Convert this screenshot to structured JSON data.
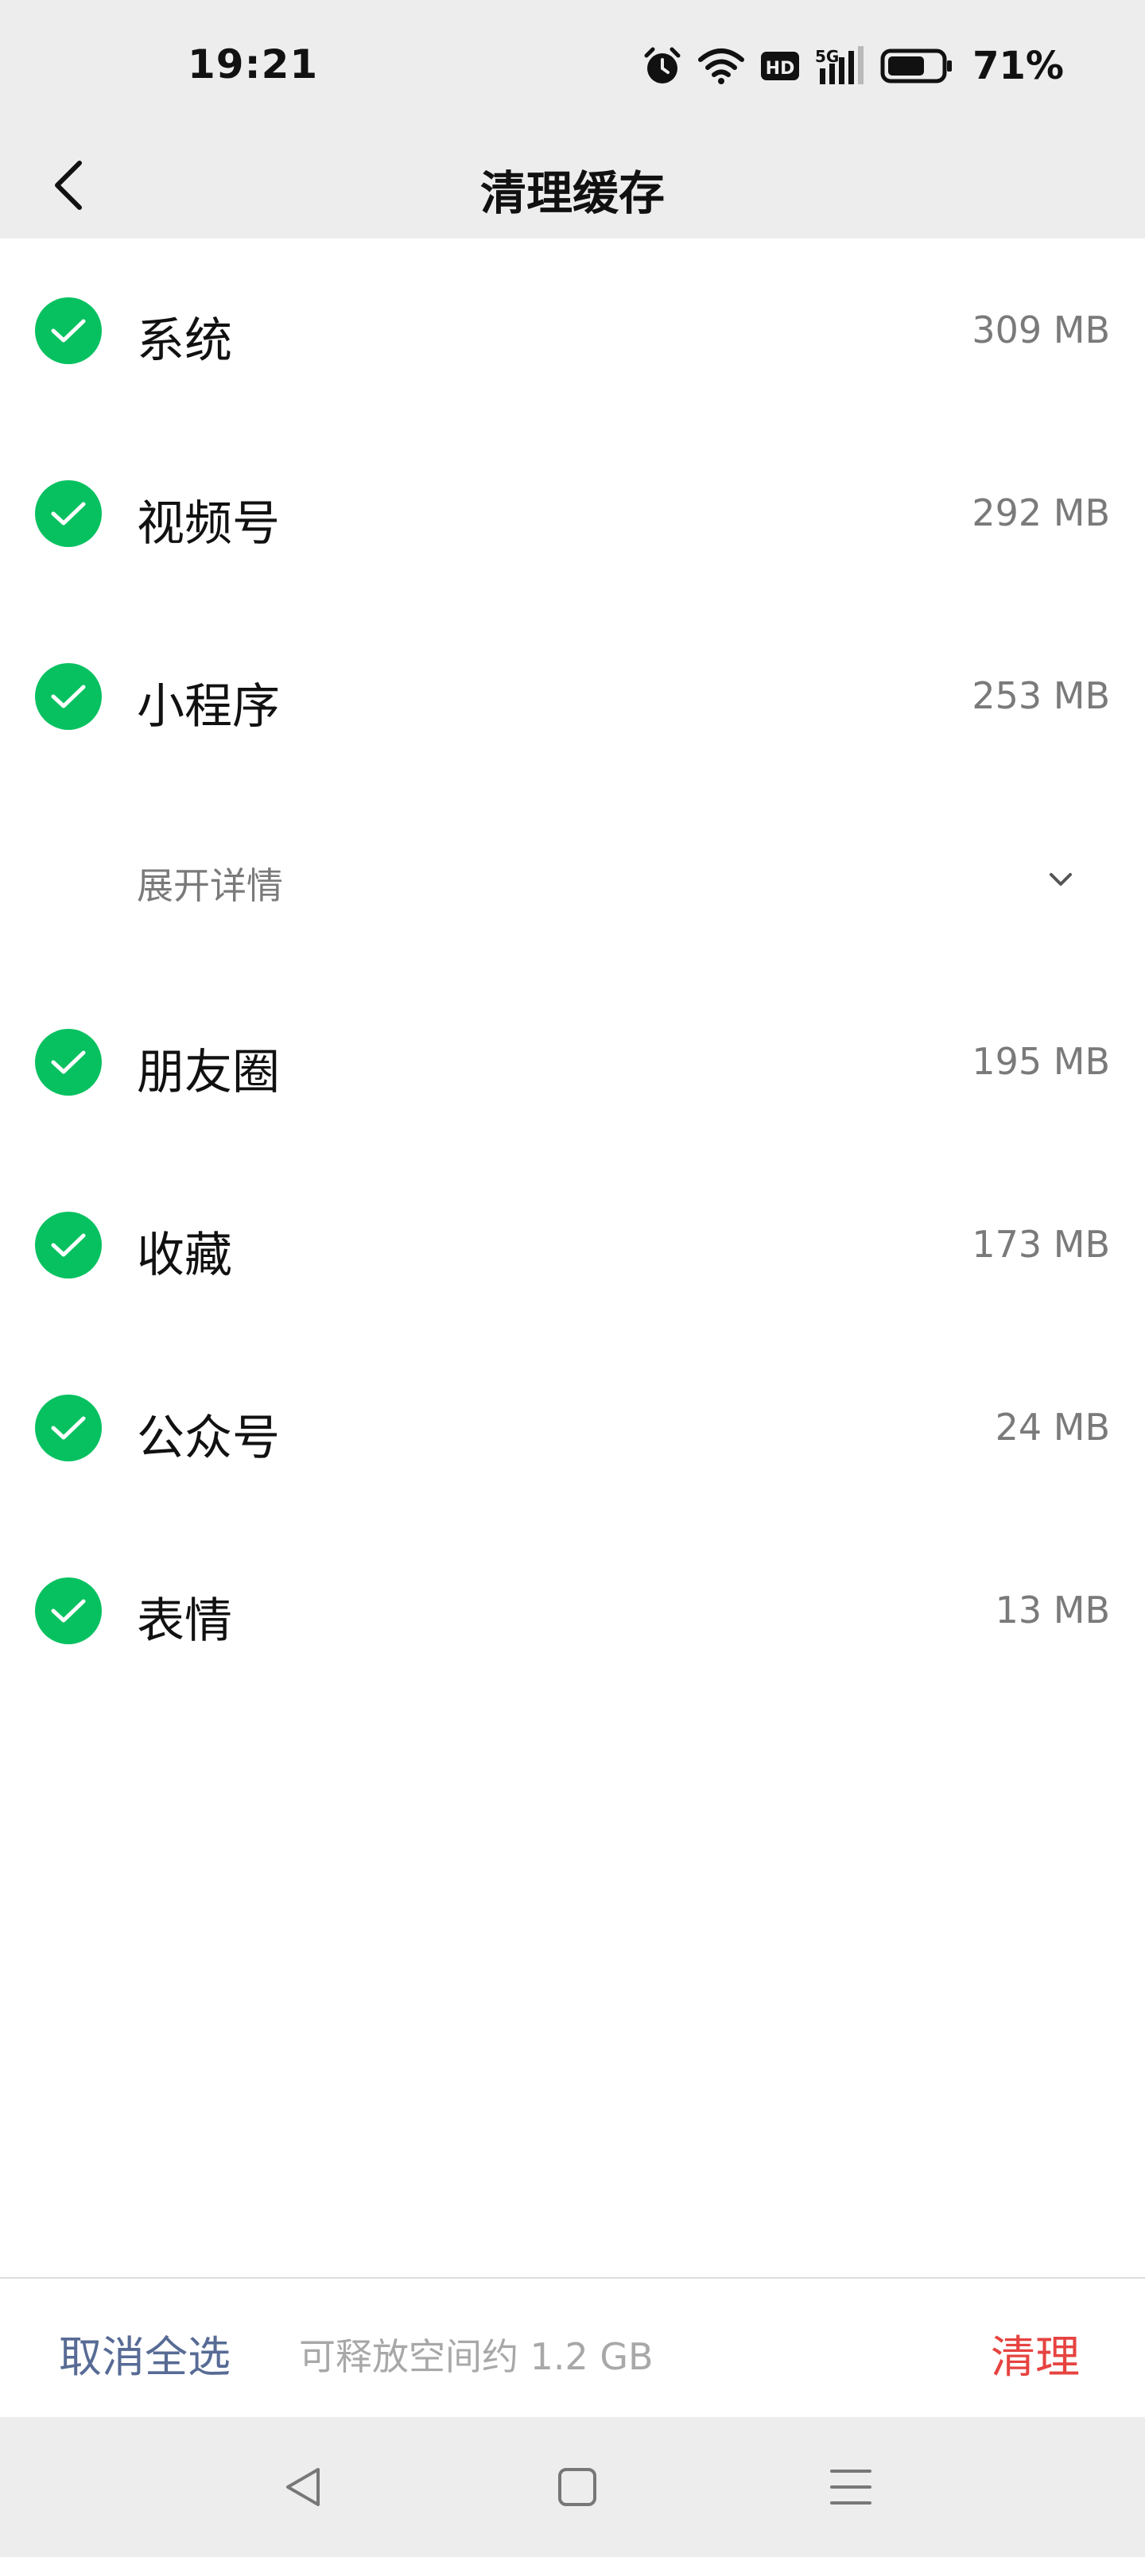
{
  "status_bar": {
    "time": "19:21",
    "battery_percent": "71%",
    "battery_level": 0.71,
    "network": "5G",
    "hd_badge": "HD",
    "icons": [
      "alarm-icon",
      "wifi-icon",
      "hd-icon",
      "signal-5g-icon",
      "battery-icon"
    ]
  },
  "nav": {
    "title": "清理缓存",
    "back_icon": "chevron-left-icon"
  },
  "items": [
    {
      "label": "系统",
      "size": "309 MB",
      "checked": true
    },
    {
      "label": "视频号",
      "size": "292 MB",
      "checked": true
    },
    {
      "label": "小程序",
      "size": "253 MB",
      "checked": true
    },
    {
      "label": "朋友圈",
      "size": "195 MB",
      "checked": true
    },
    {
      "label": "收藏",
      "size": "173 MB",
      "checked": true
    },
    {
      "label": "公众号",
      "size": "24 MB",
      "checked": true
    },
    {
      "label": "表情",
      "size": "13 MB",
      "checked": true
    }
  ],
  "expand": {
    "label": "展开详情",
    "icon": "chevron-down-icon"
  },
  "bottom": {
    "deselect_label": "取消全选",
    "free_space_text": "可释放空间约 1.2 GB",
    "clean_label": "清理"
  },
  "system_nav": {
    "icons": [
      "back-triangle-icon",
      "home-square-icon",
      "menu-lines-icon"
    ]
  },
  "colors": {
    "check_green": "#07c160",
    "link_blue": "#576b95",
    "danger_red": "#e64340",
    "header_bg": "#ededed"
  }
}
